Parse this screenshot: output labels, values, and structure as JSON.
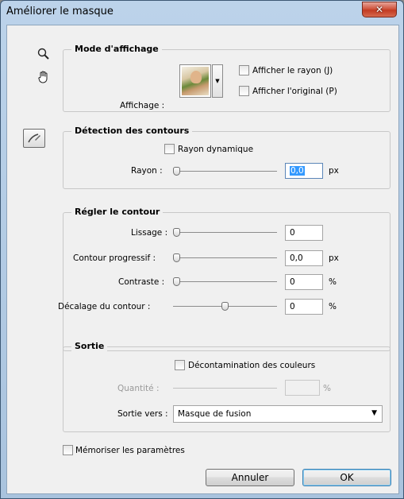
{
  "window": {
    "title": "Améliorer le masque",
    "close_glyph": "✕"
  },
  "tools": {
    "zoom_icon": "magnifier",
    "hand_icon": "hand",
    "brush_icon": "refine-radius-brush"
  },
  "view_mode": {
    "title": "Mode d'affichage",
    "view_label": "Affichage :",
    "show_radius": "Afficher le rayon (J)",
    "show_original": "Afficher l'original (P)"
  },
  "edge_detection": {
    "title": "Détection des contours",
    "smart_radius": "Rayon dynamique",
    "radius_label": "Rayon :",
    "radius_value": "0,0",
    "radius_unit": "px",
    "radius_level": 0
  },
  "adjust_edge": {
    "title": "Régler le contour",
    "rows": [
      {
        "label": "Lissage :",
        "value": "0",
        "unit": "",
        "level": 0
      },
      {
        "label": "Contour progressif :",
        "value": "0,0",
        "unit": "px",
        "level": 0
      },
      {
        "label": "Contraste :",
        "value": "0",
        "unit": "%",
        "level": 0
      },
      {
        "label": "Décalage du contour :",
        "value": "0",
        "unit": "%",
        "level": 0.5
      }
    ]
  },
  "output": {
    "title": "Sortie",
    "decontaminate": "Décontamination des couleurs",
    "amount_label": "Quantité :",
    "amount_value": "",
    "amount_unit": "%",
    "output_to_label": "Sortie vers :",
    "output_to_value": "Masque de fusion"
  },
  "remember": "Mémoriser les paramètres",
  "buttons": {
    "cancel": "Annuler",
    "ok": "OK"
  }
}
